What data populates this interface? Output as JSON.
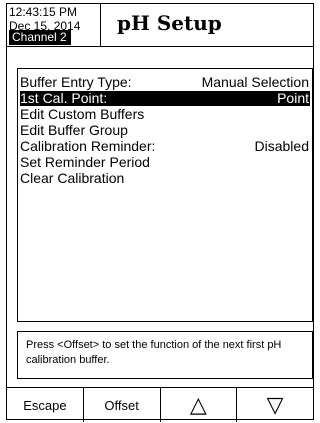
{
  "header": {
    "time": "12:43:15 PM",
    "date": "Dec 15, 2014",
    "title": "pH Setup",
    "channel": "Channel 2"
  },
  "menu": {
    "items": [
      {
        "label": "Buffer Entry Type:",
        "value": "Manual Selection",
        "selected": false
      },
      {
        "label": "1st Cal. Point:",
        "value": "Point",
        "selected": true
      },
      {
        "label": "Edit Custom Buffers",
        "value": ""
      },
      {
        "label": "Edit Buffer Group",
        "value": ""
      },
      {
        "label": "Calibration Reminder:",
        "value": "Disabled"
      },
      {
        "label": "Set Reminder Period",
        "value": ""
      },
      {
        "label": "Clear Calibration",
        "value": ""
      }
    ]
  },
  "help": {
    "text": "Press <Offset> to set the function of the next first pH calibration buffer."
  },
  "softkeys": {
    "escape": "Escape",
    "offset": "Offset",
    "up_icon": "up-triangle",
    "down_icon": "down-triangle",
    "up_glyph": "△",
    "down_glyph": "▽"
  }
}
